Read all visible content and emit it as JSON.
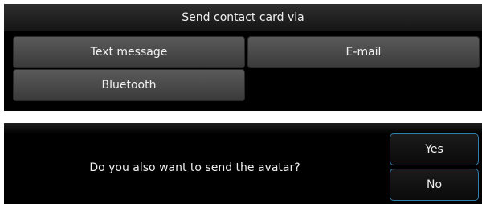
{
  "send_dialog": {
    "title": "Send contact card via",
    "options": [
      {
        "label": "Text message"
      },
      {
        "label": "E-mail"
      },
      {
        "label": "Bluetooth"
      }
    ]
  },
  "avatar_dialog": {
    "question": "Do you also want to send the avatar?",
    "yes_label": "Yes",
    "no_label": "No"
  }
}
